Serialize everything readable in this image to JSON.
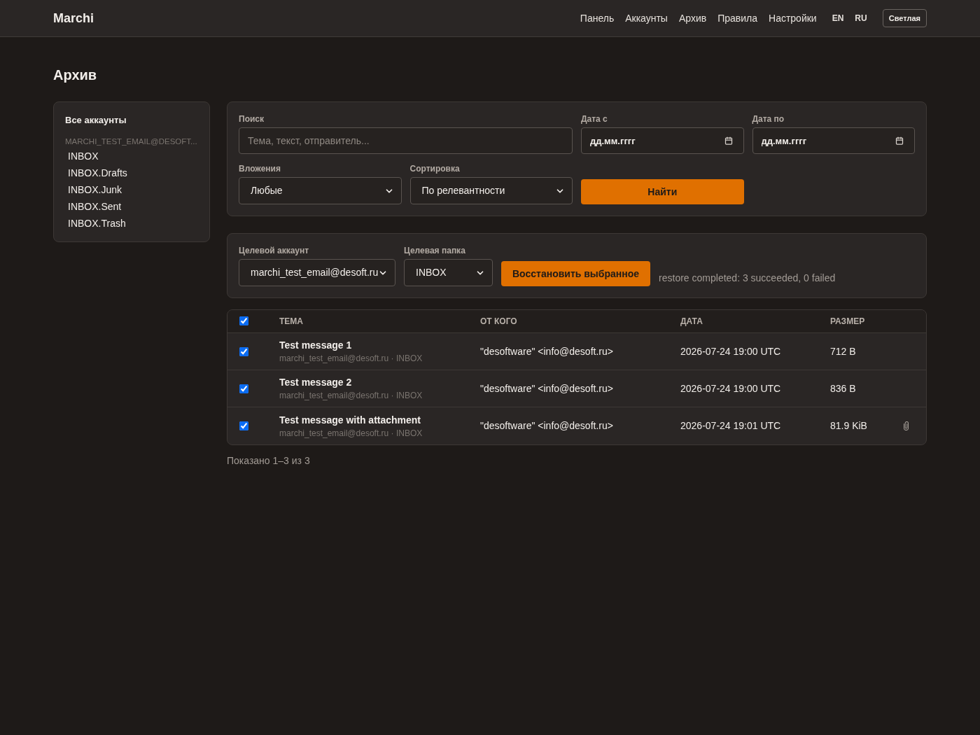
{
  "header": {
    "brand": "Marchi",
    "nav": [
      "Панель",
      "Аккаунты",
      "Архив",
      "Правила",
      "Настройки"
    ],
    "languages": [
      "EN",
      "RU"
    ],
    "theme_button": "Светлая"
  },
  "page_title": "Архив",
  "sidebar": {
    "all_accounts": "Все аккаунты",
    "accounts": [
      {
        "name": "MARCHI_TEST_EMAIL@DESOFT...",
        "folders": [
          "INBOX",
          "INBOX.Drafts",
          "INBOX.Junk",
          "INBOX.Sent",
          "INBOX.Trash"
        ]
      }
    ]
  },
  "search_panel": {
    "search": {
      "label": "Поиск",
      "placeholder": "Тема, текст, отправитель..."
    },
    "date_from": {
      "label": "Дата с",
      "placeholder": "дд.мм.гггг"
    },
    "date_to": {
      "label": "Дата по",
      "placeholder": "дд.мм.гггг"
    },
    "attachments": {
      "label": "Вложения",
      "value": "Любые"
    },
    "sort": {
      "label": "Сортировка",
      "value": "По релевантности"
    },
    "button": "Найти"
  },
  "restore_panel": {
    "target_account": {
      "label": "Целевой аккаунт",
      "value": "marchi_test_email@desoft.ru"
    },
    "target_folder": {
      "label": "Целевая папка",
      "value": "INBOX"
    },
    "button": "Восстановить выбранное",
    "status": "restore completed: 3 succeeded, 0 failed"
  },
  "table": {
    "select_all": {
      "checked": true
    },
    "columns": [
      "ТЕМА",
      "ОТ КОГО",
      "ДАТА",
      "РАЗМЕР"
    ],
    "rows": [
      {
        "checked": true,
        "subject": "Test message 1",
        "meta": "marchi_test_email@desoft.ru · INBOX",
        "from": "\"desoftware\" <info@desoft.ru>",
        "date": "2026-07-24 19:00 UTC",
        "size": "712 B",
        "attachment": false
      },
      {
        "checked": true,
        "subject": "Test message 2",
        "meta": "marchi_test_email@desoft.ru · INBOX",
        "from": "\"desoftware\" <info@desoft.ru>",
        "date": "2026-07-24 19:00 UTC",
        "size": "836 B",
        "attachment": false
      },
      {
        "checked": true,
        "subject": "Test message with attachment",
        "meta": "marchi_test_email@desoft.ru · INBOX",
        "from": "\"desoftware\" <info@desoft.ru>",
        "date": "2026-07-24 19:01 UTC",
        "size": "81.9 KiB",
        "attachment": true
      }
    ]
  },
  "footer": "Показано 1–3 из 3"
}
